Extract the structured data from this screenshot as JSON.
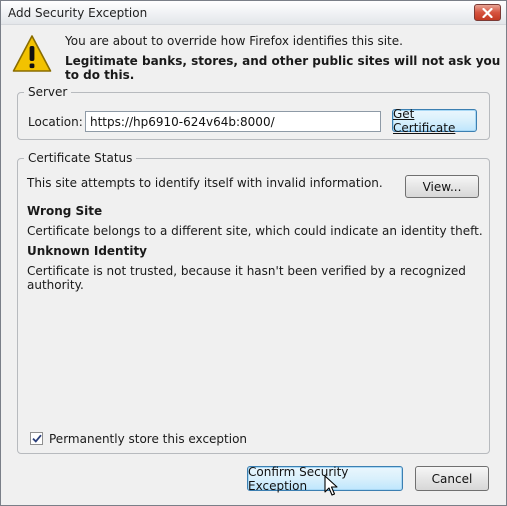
{
  "window": {
    "title": "Add Security Exception"
  },
  "message": {
    "line1": "You are about to override how Firefox identifies this site.",
    "line2": "Legitimate banks, stores, and other public sites will not ask you to do this."
  },
  "server": {
    "legend": "Server",
    "location_label": "Location:",
    "location_value": "https://hp6910-624v64b:8000/",
    "get_certificate_label": "Get Certificate"
  },
  "certificate_status": {
    "legend": "Certificate Status",
    "summary": "This site attempts to identify itself with invalid information.",
    "view_label": "View...",
    "wrong_site_heading": "Wrong Site",
    "wrong_site_text": "Certificate belongs to a different site, which could indicate an identity theft.",
    "unknown_identity_heading": "Unknown Identity",
    "unknown_identity_text": "Certificate is not trusted, because it hasn't been verified by a recognized authority."
  },
  "permanent": {
    "label": "Permanently store this exception",
    "checked": true
  },
  "buttons": {
    "confirm_label": "Confirm Security Exception",
    "cancel_label": "Cancel"
  },
  "icons": {
    "close": "close-icon",
    "warning": "warning-icon",
    "checkmark": "checkmark-icon",
    "cursor": "mouse-pointer-icon"
  },
  "colors": {
    "close_button": "#d6533f",
    "warning_yellow": "#f2c200",
    "default_button_border": "#3c7fb1"
  }
}
